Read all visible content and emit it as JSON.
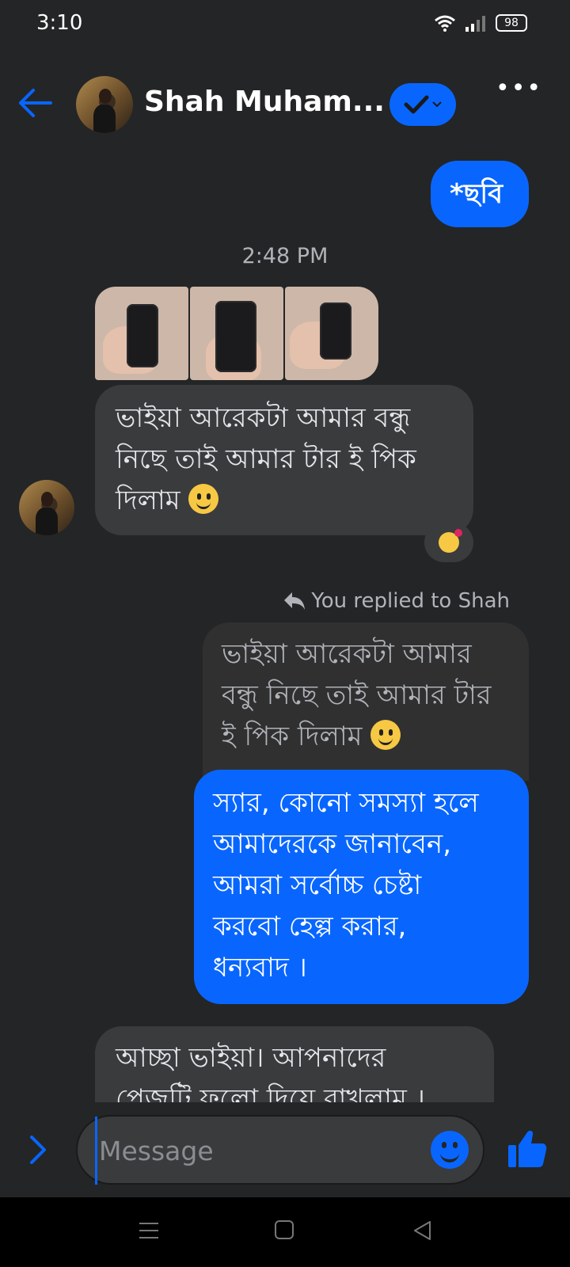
{
  "status_bar": {
    "time": "3:10",
    "battery": "98"
  },
  "header": {
    "contact_name": "Shah Muham..."
  },
  "messages": {
    "sent_1": "*ছবি",
    "timestamp": "2:48 PM",
    "received_1_lines": [
      "ভাইয়া আরেকটা আমার বন্ধু",
      "নিছে তাই আমার টার ই পিক",
      "দিলাম"
    ],
    "replied_note": "You replied to Shah",
    "quoted_lines": [
      "ভাইয়া আরেকটা আমার",
      "বন্ধু নিছে তাই আমার টার",
      "ই পিক দিলাম"
    ],
    "sent_2_lines": [
      "স্যার, কোনো সমস্যা হলে",
      "আমাদেরকে জানাবেন,",
      "আমরা সর্বোচ্চ চেষ্টা",
      "করবো হেল্প করার,",
      "ধন্যবাদ ।"
    ],
    "received_2_lines": [
      "আচ্ছা ভাইয়া। আপনাদের",
      "পেজটি ফলো দিয়ে রাখলাম ।"
    ]
  },
  "composer": {
    "placeholder": "Message"
  },
  "colors": {
    "accent": "#0866ff",
    "background": "#242526",
    "incoming_bubble": "#3a3b3c"
  }
}
